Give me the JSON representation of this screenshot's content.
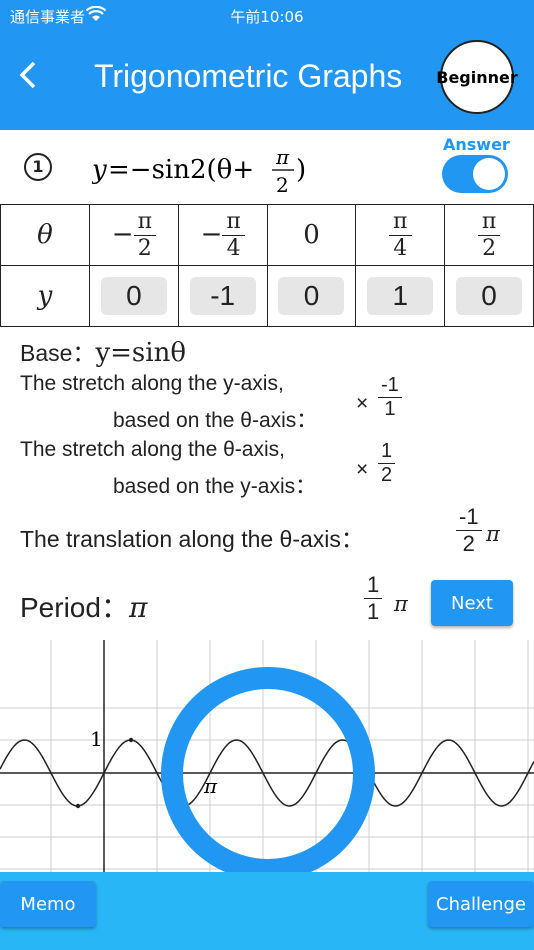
{
  "status": {
    "carrier": "通信事業者",
    "time": "午前10:06"
  },
  "header": {
    "title": "Trigonometric Graphs",
    "level": "Beginner"
  },
  "question": {
    "number": "1",
    "equation": "y=−sin2(θ+π/2)"
  },
  "answer": {
    "label": "Answer",
    "on": true
  },
  "table": {
    "row1_label": "θ",
    "row2_label": "y",
    "theta": [
      {
        "sign": "−",
        "num": "π",
        "den": "2"
      },
      {
        "sign": "−",
        "num": "π",
        "den": "4"
      },
      {
        "plain": "0"
      },
      {
        "sign": "",
        "num": "π",
        "den": "4"
      },
      {
        "sign": "",
        "num": "π",
        "den": "2"
      }
    ],
    "y": [
      "0",
      "-1",
      "0",
      "1",
      "0"
    ]
  },
  "base": {
    "label": "Base：",
    "value": "y=sinθ"
  },
  "stretch_y": {
    "line1": "The stretch along the y-axis,",
    "line2": "based on the θ-axis：",
    "times": "×",
    "num": "-1",
    "den": "1"
  },
  "stretch_theta": {
    "line1": "The stretch along the θ-axis,",
    "line2": "based on the y-axis：",
    "times": "×",
    "num": "1",
    "den": "2"
  },
  "translation": {
    "label": "The translation along the θ-axis：",
    "num": "-1",
    "den": "2",
    "suffix": "π"
  },
  "period": {
    "label": "Period：",
    "value": "π",
    "num": "1",
    "den": "1",
    "suffix": "π"
  },
  "next_label": "Next",
  "graph": {
    "y_tick": "1",
    "x_tick": "π"
  },
  "footer": {
    "memo": "Memo",
    "challenge": "Challenge"
  },
  "colors": {
    "primary": "#2196f3",
    "footer": "#29b6f6",
    "ring": "#2196f3"
  }
}
